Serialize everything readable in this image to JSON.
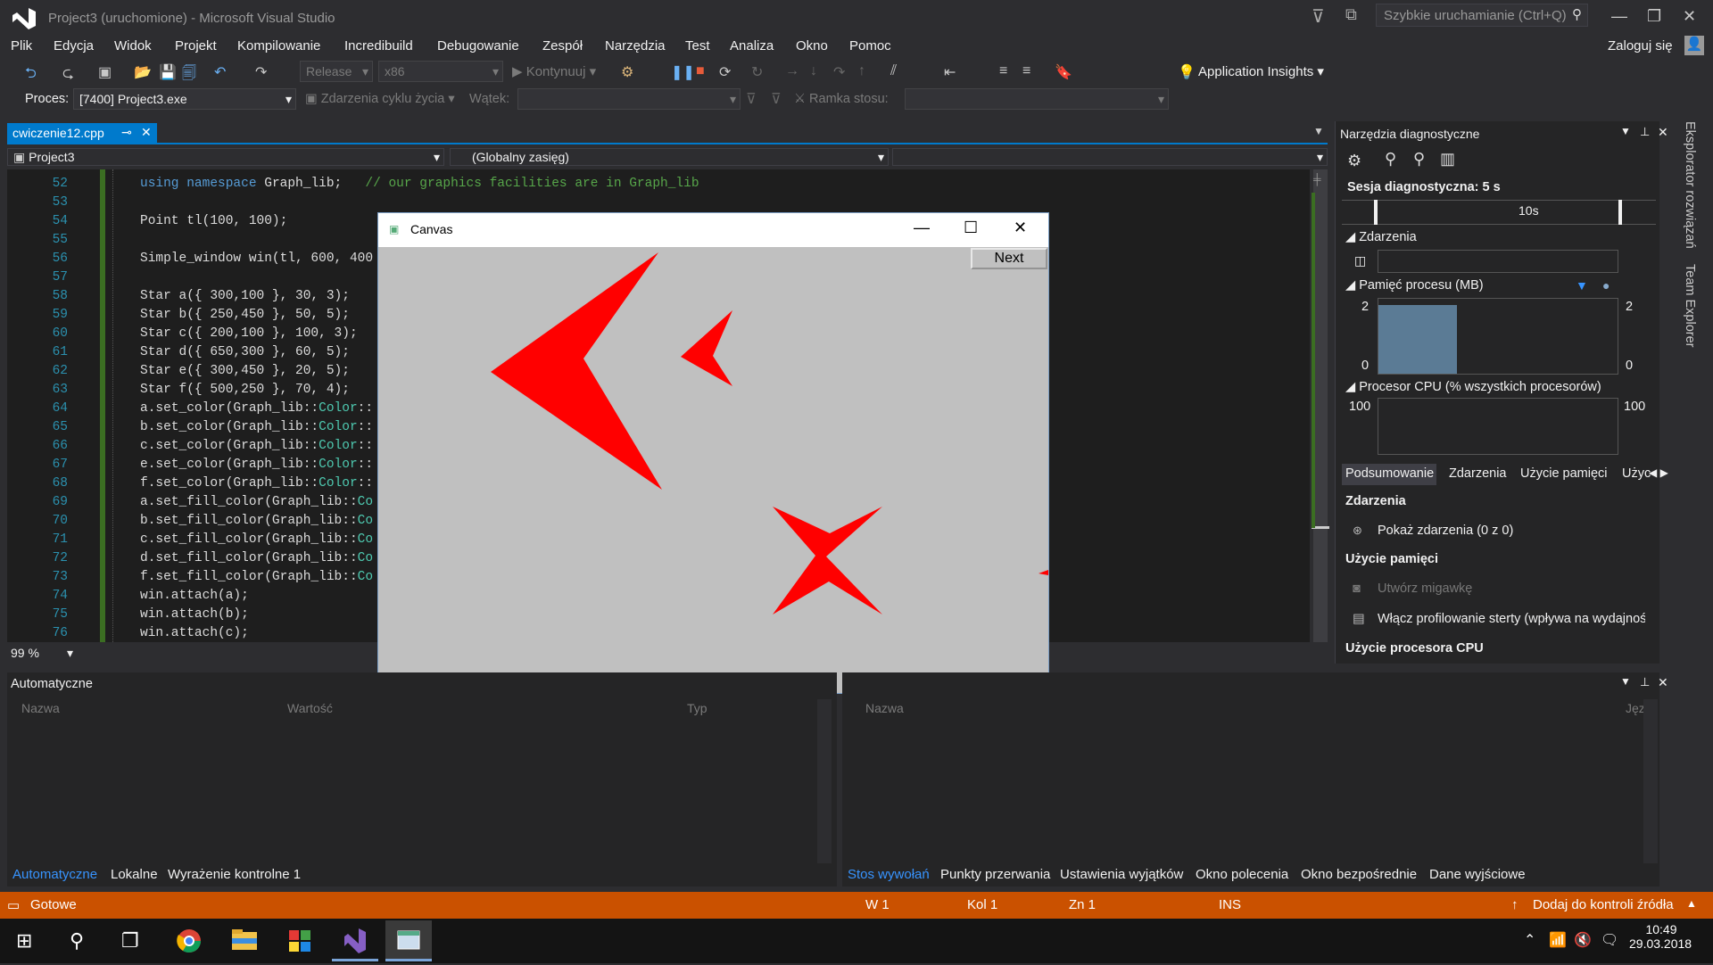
{
  "window": {
    "title": "Project3 (uruchomione) - Microsoft Visual Studio",
    "quick_launch_placeholder": "Szybkie uruchamianie (Ctrl+Q)",
    "signin": "Zaloguj się"
  },
  "menu": [
    "Plik",
    "Edycja",
    "Widok",
    "Projekt",
    "Kompilowanie",
    "Incredibuild",
    "Debugowanie",
    "Zespół",
    "Narzędzia",
    "Test",
    "Analiza",
    "Okno",
    "Pomoc"
  ],
  "toolbar": {
    "config": "Release",
    "platform": "x86",
    "continue": "Kontynuuj",
    "app_insights": "Application Insights"
  },
  "debugbar": {
    "process_label": "Proces:",
    "process_value": "[7400] Project3.exe",
    "lifecycle": "Zdarzenia cyklu życia",
    "thread_label": "Wątek:",
    "stackframe_label": "Ramka stosu:"
  },
  "editor": {
    "tab": "cwiczenie12.cpp",
    "project": "Project3",
    "scope": "(Globalny zasięg)",
    "zoom": "99 %",
    "lines": [
      {
        "n": "52",
        "text": "using namespace Graph_lib;   // our graphics facilities are in Graph_lib"
      },
      {
        "n": "53",
        "text": ""
      },
      {
        "n": "54",
        "text": "Point tl(100, 100);"
      },
      {
        "n": "55",
        "text": ""
      },
      {
        "n": "56",
        "text": "Simple_window win(tl, 600, 400"
      },
      {
        "n": "57",
        "text": ""
      },
      {
        "n": "58",
        "text": "Star a({ 300,100 }, 30, 3);"
      },
      {
        "n": "59",
        "text": "Star b({ 250,450 }, 50, 5);"
      },
      {
        "n": "60",
        "text": "Star c({ 200,100 }, 100, 3);"
      },
      {
        "n": "61",
        "text": "Star d({ 650,300 }, 60, 5);"
      },
      {
        "n": "62",
        "text": "Star e({ 300,450 }, 20, 5);"
      },
      {
        "n": "63",
        "text": "Star f({ 500,250 }, 70, 4);"
      },
      {
        "n": "64",
        "text": "a.set_color(Graph_lib::Color::"
      },
      {
        "n": "65",
        "text": "b.set_color(Graph_lib::Color::"
      },
      {
        "n": "66",
        "text": "c.set_color(Graph_lib::Color::"
      },
      {
        "n": "67",
        "text": "e.set_color(Graph_lib::Color::"
      },
      {
        "n": "68",
        "text": "f.set_color(Graph_lib::Color::"
      },
      {
        "n": "69",
        "text": "a.set_fill_color(Graph_lib::Co"
      },
      {
        "n": "70",
        "text": "b.set_fill_color(Graph_lib::Co"
      },
      {
        "n": "71",
        "text": "c.set_fill_color(Graph_lib::Co"
      },
      {
        "n": "72",
        "text": "d.set_fill_color(Graph_lib::Co"
      },
      {
        "n": "73",
        "text": "f.set_fill_color(Graph_lib::Co"
      },
      {
        "n": "74",
        "text": "win.attach(a);"
      },
      {
        "n": "75",
        "text": "win.attach(b);"
      },
      {
        "n": "76",
        "text": "win.attach(c);"
      }
    ]
  },
  "canvas": {
    "title": "Canvas",
    "next_label": "Next",
    "star_color": "#ff0000"
  },
  "diag": {
    "title": "Narzędzia diagnostyczne",
    "session": "Sesja diagnostyczna: 5 s",
    "timeline_label": "10s",
    "events": "Zdarzenia",
    "memory": "Pamięć procesu (MB)",
    "mem_max": "2",
    "mem_min": "0",
    "cpu": "Procesor CPU (% wszystkich procesorów)",
    "cpu_max": "100",
    "tabs": [
      "Podsumowanie",
      "Zdarzenia",
      "Użycie pamięci",
      "Użyc"
    ],
    "sec_events": "Zdarzenia",
    "show_events": "Pokaż zdarzenia (0 z 0)",
    "sec_memory": "Użycie pamięci",
    "snapshot": "Utwórz migawkę",
    "heap": "Włącz profilowanie sterty (wpływa na wydajnoś",
    "sec_cpu": "Użycie procesora CPU"
  },
  "side_tabs": [
    "Eksplorator rozwiązań",
    "Team Explorer"
  ],
  "autos": {
    "title": "Automatyczne",
    "cols": [
      "Nazwa",
      "Wartość",
      "Typ"
    ],
    "tabs": [
      "Automatyczne",
      "Lokalne",
      "Wyrażenie kontrolne 1"
    ]
  },
  "callstack": {
    "cols": [
      "Nazwa",
      "Język"
    ],
    "tabs": [
      "Stos wywołań",
      "Punkty przerwania",
      "Ustawienia wyjątków",
      "Okno polecenia",
      "Okno bezpośrednie",
      "Dane wyjściowe"
    ]
  },
  "status": {
    "ready": "Gotowe",
    "w": "W 1",
    "kol": "Kol 1",
    "zn": "Zn 1",
    "ins": "INS",
    "source": "Dodaj do kontroli źródła"
  },
  "taskbar": {
    "time": "10:49",
    "date": "29.03.2018"
  }
}
